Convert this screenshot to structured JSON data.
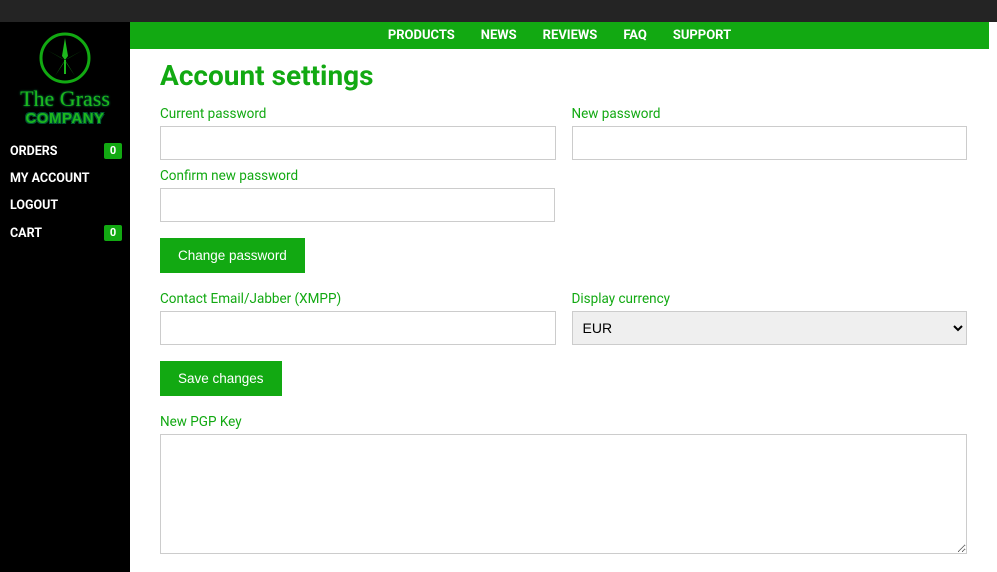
{
  "brand": {
    "line1": "The Grass",
    "line2": "COMPANY"
  },
  "sidebar": {
    "items": [
      {
        "label": "ORDERS",
        "badge": "0"
      },
      {
        "label": "MY ACCOUNT"
      },
      {
        "label": "LOGOUT"
      },
      {
        "label": "CART",
        "badge": "0"
      }
    ]
  },
  "topnav": {
    "items": [
      "PRODUCTS",
      "NEWS",
      "REVIEWS",
      "FAQ",
      "SUPPORT"
    ]
  },
  "page": {
    "title": "Account settings",
    "labels": {
      "current_password": "Current password",
      "new_password": "New password",
      "confirm_new_password": "Confirm new password",
      "change_password_btn": "Change password",
      "contact": "Contact Email/Jabber (XMPP)",
      "display_currency": "Display currency",
      "save_changes_btn": "Save changes",
      "new_pgp": "New PGP Key"
    },
    "values": {
      "current_password": "",
      "new_password": "",
      "confirm_new_password": "",
      "contact": "",
      "currency": "EUR",
      "pgp": ""
    },
    "currency_options": [
      "EUR"
    ]
  },
  "colors": {
    "primary_green": "#12a912",
    "dark_bg": "#000000",
    "topbar": "#242424"
  }
}
